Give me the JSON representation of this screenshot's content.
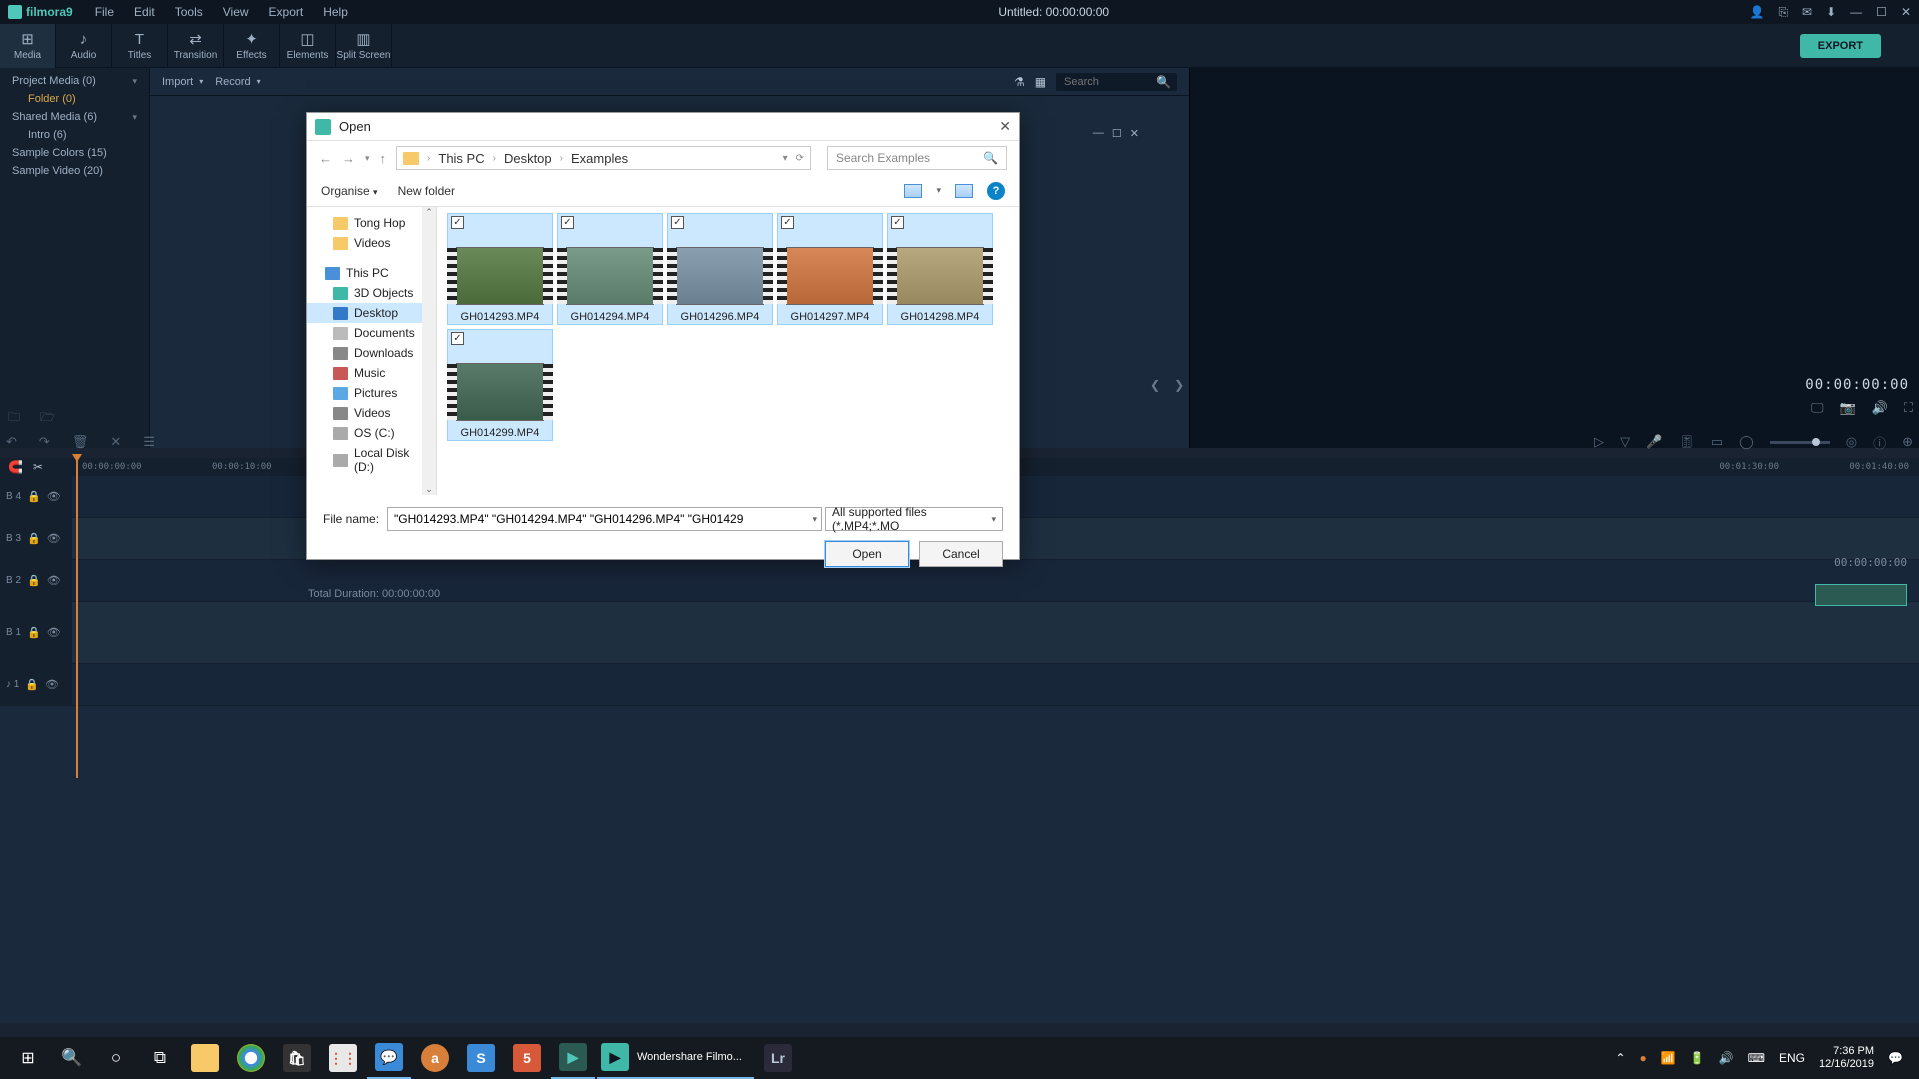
{
  "title_bar": {
    "app_name": "filmora9",
    "menus": [
      "File",
      "Edit",
      "Tools",
      "View",
      "Export",
      "Help"
    ],
    "center": "Untitled:  00:00:00:00"
  },
  "toolbar": {
    "tabs": [
      {
        "label": "Media",
        "icon": "⊞"
      },
      {
        "label": "Audio",
        "icon": "♪"
      },
      {
        "label": "Titles",
        "icon": "T"
      },
      {
        "label": "Transition",
        "icon": "⇄"
      },
      {
        "label": "Effects",
        "icon": "✦"
      },
      {
        "label": "Elements",
        "icon": "◫"
      },
      {
        "label": "Split Screen",
        "icon": "▥"
      }
    ],
    "export": "EXPORT"
  },
  "media_panel": {
    "nodes": [
      {
        "label": "Project Media (0)",
        "ex": true
      },
      {
        "label": "Folder (0)",
        "sub": true,
        "sel": true
      },
      {
        "label": "Shared Media (6)",
        "ex": true
      },
      {
        "label": "Intro (6)",
        "sub": true
      },
      {
        "label": "Sample Colors (15)"
      },
      {
        "label": "Sample Video (20)"
      }
    ]
  },
  "browser": {
    "import": "Import",
    "record": "Record",
    "search_ph": "Search"
  },
  "preview": {
    "timecode": "00:00:00:00"
  },
  "dialog": {
    "title": "Open",
    "crumbs": [
      "This PC",
      "Desktop",
      "Examples"
    ],
    "search_ph": "Search Examples",
    "organise": "Organise",
    "new_folder": "New folder",
    "tree": [
      {
        "label": "Tong Hop",
        "ico": "ico-folder"
      },
      {
        "label": "Videos",
        "ico": "ico-folder"
      },
      {
        "label": "This PC",
        "ico": "ico-pc",
        "lvl0": true
      },
      {
        "label": "3D Objects",
        "ico": "ico-3d"
      },
      {
        "label": "Desktop",
        "ico": "ico-desktop",
        "sel": true
      },
      {
        "label": "Documents",
        "ico": "ico-doc"
      },
      {
        "label": "Downloads",
        "ico": "ico-dl"
      },
      {
        "label": "Music",
        "ico": "ico-music"
      },
      {
        "label": "Pictures",
        "ico": "ico-pic"
      },
      {
        "label": "Videos",
        "ico": "ico-vid"
      },
      {
        "label": "OS (C:)",
        "ico": "ico-disk"
      },
      {
        "label": "Local Disk (D:)",
        "ico": "ico-disk"
      }
    ],
    "files": [
      {
        "name": "GH014293.MP4",
        "t": "t1",
        "sel": true,
        "chk": true
      },
      {
        "name": "GH014294.MP4",
        "t": "t2",
        "sel": true,
        "chk": true
      },
      {
        "name": "GH014296.MP4",
        "t": "t3",
        "sel": true,
        "chk": true
      },
      {
        "name": "GH014297.MP4",
        "t": "t4",
        "sel": true,
        "chk": true
      },
      {
        "name": "GH014298.MP4",
        "t": "t5",
        "sel": true,
        "chk": true
      },
      {
        "name": "GH014299.MP4",
        "t": "t6",
        "sel": true,
        "chk": true
      }
    ],
    "fn_label": "File name:",
    "fn_value": "\"GH014293.MP4\" \"GH014294.MP4\" \"GH014296.MP4\" \"GH01429",
    "filter": "All supported files (*.MP4;*.MO",
    "open": "Open",
    "cancel": "Cancel"
  },
  "timeline": {
    "ticks": [
      "00:00:00:00",
      "00:00:10:00"
    ],
    "ticks_r": [
      "00:01:30:00",
      "00:01:40:00"
    ],
    "tracks": [
      {
        "id": "B 4"
      },
      {
        "id": "B 3"
      },
      {
        "id": "B 2"
      },
      {
        "id": "B 1",
        "large": true
      },
      {
        "id": "♪ 1"
      }
    ],
    "total_label": "Total Duration:  00:00:00:00",
    "total_tc": "00:00:00:00"
  },
  "taskbar": {
    "filmora_label": "Wondershare Filmo...",
    "lang": "ENG",
    "time": "7:36 PM",
    "date": "12/16/2019"
  }
}
